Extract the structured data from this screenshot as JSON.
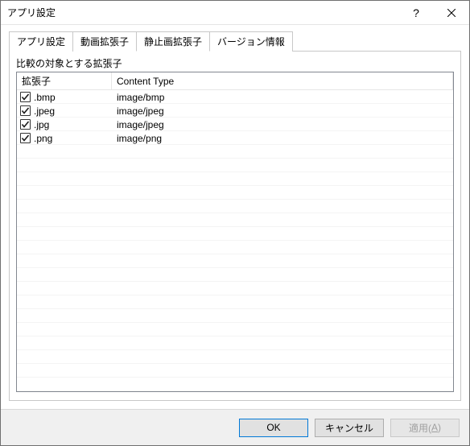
{
  "window": {
    "title": "アプリ設定"
  },
  "tabs": {
    "items": [
      {
        "label": "アプリ設定"
      },
      {
        "label": "動画拡張子"
      },
      {
        "label": "静止画拡張子"
      },
      {
        "label": "バージョン情報"
      }
    ],
    "active_index": 2
  },
  "group": {
    "title": "比較の対象とする拡張子"
  },
  "columns": {
    "ext": "拡張子",
    "ct": "Content Type"
  },
  "rows": [
    {
      "checked": true,
      "ext": ".bmp",
      "ct": "image/bmp"
    },
    {
      "checked": true,
      "ext": ".jpeg",
      "ct": "image/jpeg"
    },
    {
      "checked": true,
      "ext": ".jpg",
      "ct": "image/jpeg"
    },
    {
      "checked": true,
      "ext": ".png",
      "ct": "image/png"
    }
  ],
  "buttons": {
    "ok": "OK",
    "cancel": "キャンセル",
    "apply_prefix": "適用(",
    "apply_key": "A",
    "apply_suffix": ")"
  }
}
